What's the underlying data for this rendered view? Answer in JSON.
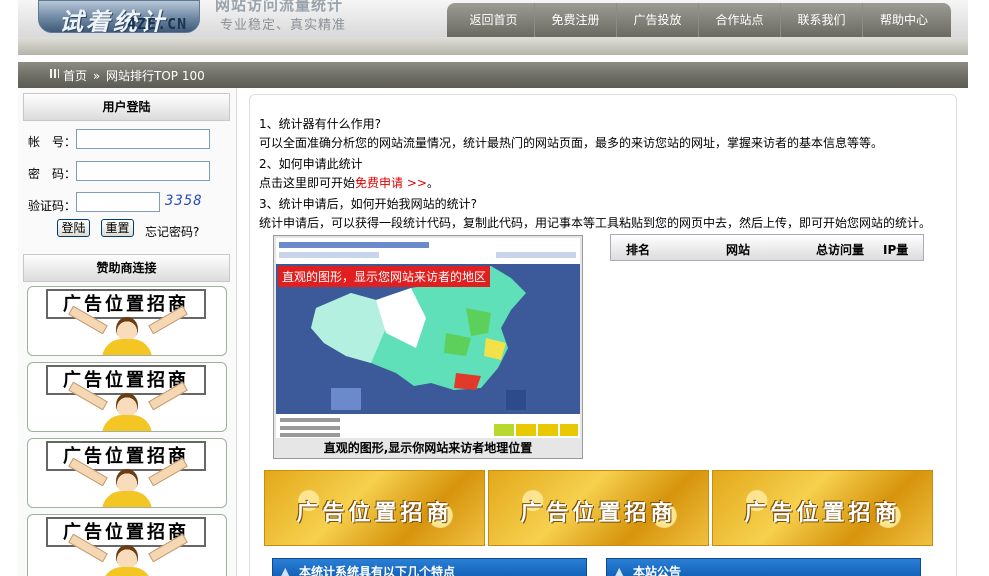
{
  "header": {
    "logo_cn": "试着统计",
    "logo_tag": "统计",
    "logo_en": "4ZE.CN",
    "site_title": "网站访问流量统计",
    "slogan": "专业稳定、真实精准"
  },
  "nav": {
    "items": [
      "返回首页",
      "免费注册",
      "广告投放",
      "合作站点",
      "联系我们",
      "帮助中心"
    ]
  },
  "breadcrumb": {
    "home": "首页",
    "sep": "»",
    "current": "网站排行TOP 100"
  },
  "login": {
    "title": "用户登陆",
    "account_label": "帐　号：",
    "password_label": "密　码：",
    "captcha_label": "验证码：",
    "captcha_code": "3358",
    "login_button": "登陆",
    "reset_button": "重置",
    "forgot_link": "忘记密码?"
  },
  "sponsors": {
    "title": "赞助商连接",
    "items": [
      "广告位置招商",
      "广告位置招商",
      "广告位置招商",
      "广告位置招商"
    ]
  },
  "faq": {
    "q1": "1、统计器有什么作用?",
    "a1": "可以全面准确分析您的网站流量情况，统计最热门的网站页面，最多的来访您站的网址，掌握来访者的基本信息等等。",
    "q2": "2、如何申请此统计",
    "a2_prefix": "点击这里即可开始",
    "a2_link": "免费申请 >>",
    "a2_suffix": "。",
    "q3": "3、统计申请后，如何开始我网站的统计?",
    "a3": "统计申请后，可以获得一段统计代码，复制此代码，用记事本等工具粘贴到您的网页中去，然后上传，即可开始您网站的统计。"
  },
  "map": {
    "overlay_label": "直观的图形，显示您网站来访者的地区",
    "caption": "直观的图形,显示你网站来访者地理位置"
  },
  "ranking": {
    "col_rank": "排名",
    "col_site": "网站",
    "col_total": "总访问量",
    "col_ip": "IP量"
  },
  "ads": {
    "banners": [
      "广告位置招商",
      "广告位置招商",
      "广告位置招商"
    ]
  },
  "sections": {
    "features_title": "本统计系统具有以下几个特点",
    "notice_title": "本站公告"
  },
  "colors": {
    "nav_bg": "#7f7f77",
    "link_red": "#e00000",
    "section_blue": "#0a57b0",
    "ad_gold": "#e3a81a"
  }
}
